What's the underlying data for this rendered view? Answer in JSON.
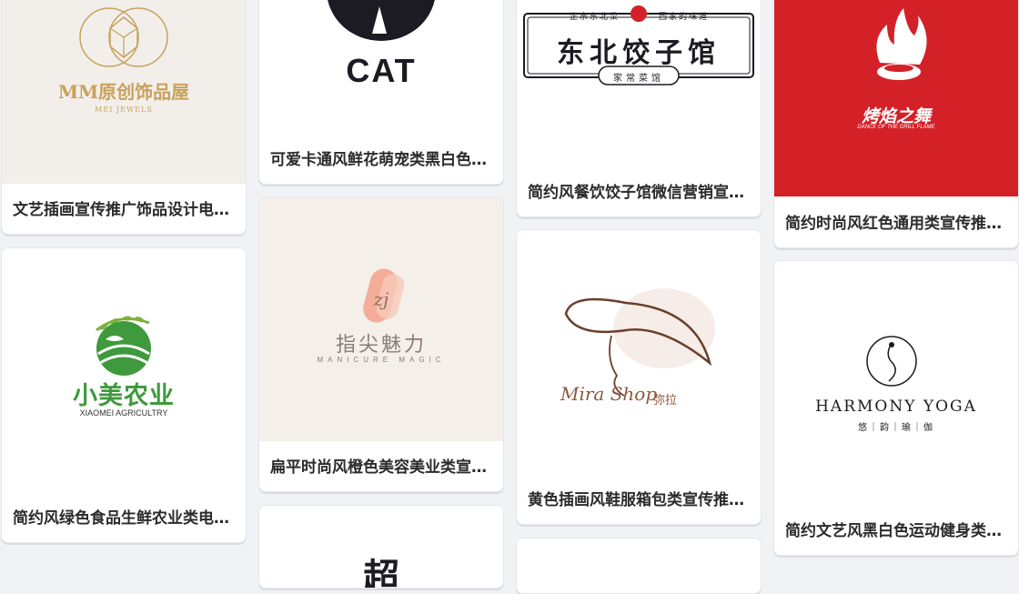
{
  "cards": [
    {
      "caption": "文艺插画宣传推广饰品设计电…",
      "brand": "MM原创饰品屋",
      "sub": "MEI JEWELS"
    },
    {
      "caption": "可爱卡通风鲜花萌宠类黑白色…",
      "brand": "CAT"
    },
    {
      "caption": "简约风餐饮饺子馆微信营销宣…",
      "brand": "东北饺子馆",
      "top_left": "正宗东北菜",
      "top_right": "回家的味道",
      "bottom": "家常菜馆"
    },
    {
      "caption": "简约时尚风红色通用类宣传推…",
      "brand": "烤焰之舞",
      "sub": "DANCE OF THE GRILL FLAME"
    },
    {
      "caption": "简约风绿色食品生鲜农业类电…",
      "brand": "小美农业",
      "sub": "XIAOMEI AGRICULTRY"
    },
    {
      "caption": "扁平时尚风橙色美容美业类宣…",
      "brand": "指尖魅力",
      "sub": "MANICURE MAGIC",
      "mark": "zj"
    },
    {
      "caption": "黄色插画风鞋服箱包类宣传推…",
      "brand": "Mira Shop",
      "cn": "弥拉"
    },
    {
      "caption": "简约文艺风黑白色运动健身类…",
      "brand": "HARMONY YOGA",
      "cn": "悠｜韵｜瑜｜伽"
    },
    {
      "brand": "超"
    }
  ],
  "colors": {
    "gold": "#c8a15a",
    "red": "#d42027",
    "green": "#3e9a3c",
    "peach": "#f3a18a"
  }
}
